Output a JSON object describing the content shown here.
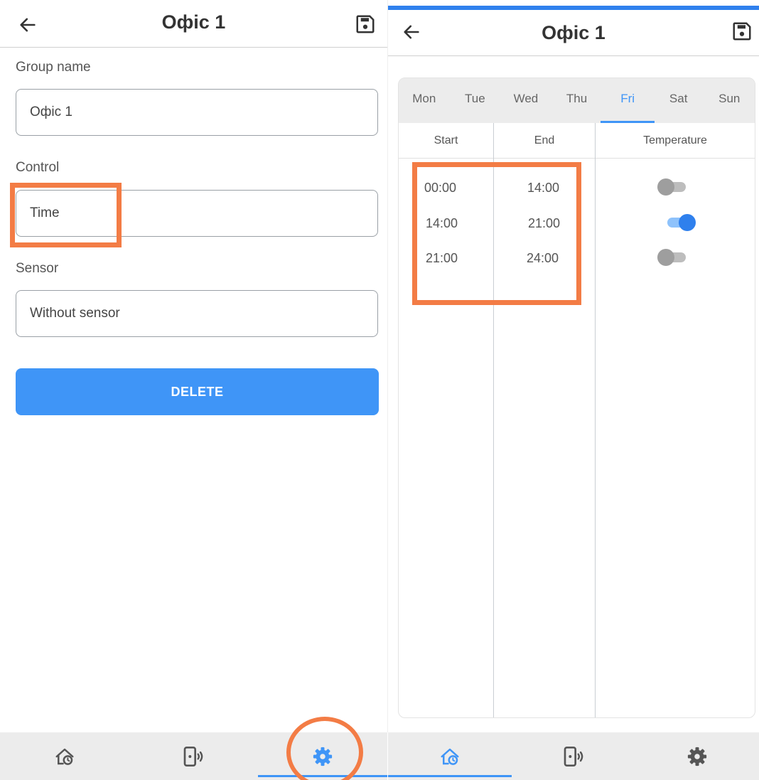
{
  "left_screen": {
    "header": {
      "title": "Офіс 1",
      "back_icon": "arrow-left-icon",
      "save_icon": "floppy-disk-icon"
    },
    "group_name": {
      "label": "Group name",
      "value": "Офіс 1"
    },
    "control": {
      "label": "Control",
      "value": "Time"
    },
    "sensor": {
      "label": "Sensor",
      "value": "Without sensor"
    },
    "delete_label": "DELETE",
    "nav": [
      {
        "icon": "home-clock-icon",
        "active": false
      },
      {
        "icon": "phone-signal-icon",
        "active": false
      },
      {
        "icon": "gear-icon",
        "active": true
      }
    ]
  },
  "right_screen": {
    "header": {
      "title": "Офіс 1",
      "back_icon": "arrow-left-icon",
      "save_icon": "floppy-disk-icon"
    },
    "days": [
      "Mon",
      "Tue",
      "Wed",
      "Thu",
      "Fri",
      "Sat",
      "Sun"
    ],
    "active_day": "Fri",
    "columns": {
      "start": "Start",
      "end": "End",
      "temperature": "Temperature"
    },
    "rows": [
      {
        "start": "00:00",
        "end": "14:00",
        "temperature_on": false
      },
      {
        "start": "14:00",
        "end": "21:00",
        "temperature_on": true
      },
      {
        "start": "21:00",
        "end": "24:00",
        "temperature_on": false
      }
    ],
    "nav": [
      {
        "icon": "home-clock-icon",
        "active": true
      },
      {
        "icon": "phone-signal-icon",
        "active": false
      },
      {
        "icon": "gear-icon",
        "active": false
      }
    ]
  },
  "colors": {
    "accent": "#3f95f7",
    "annotation": "#f37c45",
    "nav_background": "#ececec",
    "toggle_on": "#2f80ed"
  }
}
